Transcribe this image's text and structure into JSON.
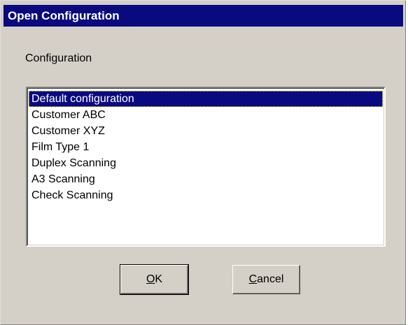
{
  "window": {
    "title": "Open Configuration"
  },
  "configuration": {
    "label": "Configuration",
    "items": [
      "Default configuration",
      "Customer ABC",
      "Customer XYZ",
      "Film Type 1",
      "Duplex Scanning",
      "A3 Scanning",
      "Check Scanning"
    ],
    "selected_index": 0
  },
  "buttons": {
    "ok": {
      "accel": "O",
      "rest": "K"
    },
    "cancel": {
      "accel": "C",
      "rest": "ancel"
    }
  },
  "colors": {
    "titlebar": "#0a0a80",
    "selection": "#0a0a80",
    "face": "#d4d0c8"
  }
}
